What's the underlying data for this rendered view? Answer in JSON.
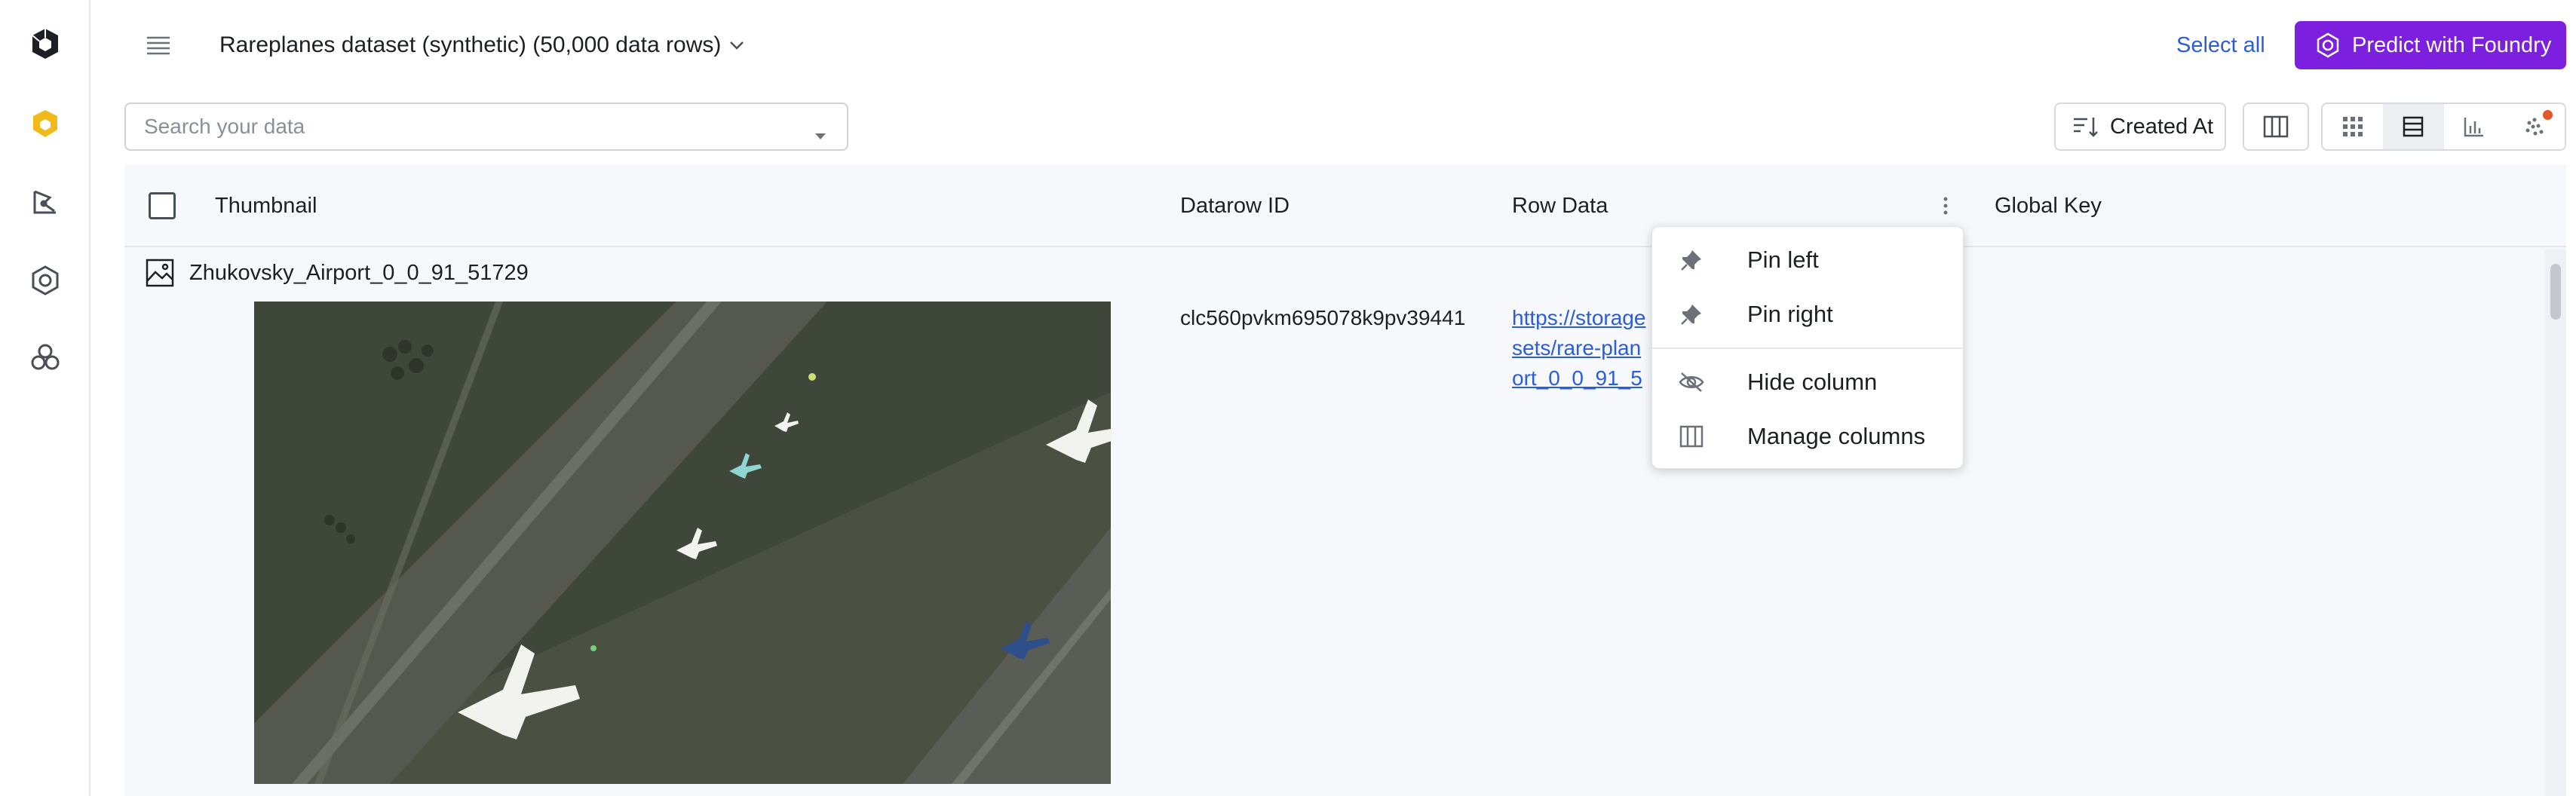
{
  "header": {
    "dataset_title": "Rareplanes dataset (synthetic) (50,000 data rows)",
    "select_all_label": "Select all",
    "predict_label": "Predict with Foundry"
  },
  "search": {
    "placeholder": "Search your data"
  },
  "toolbar": {
    "sort_label": "Created At"
  },
  "table": {
    "columns": [
      "Thumbnail",
      "Datarow ID",
      "Row Data",
      "Global Key"
    ],
    "rows": [
      {
        "name": "Zhukovsky_Airport_0_0_91_51729",
        "datarow_id": "clc560pvkm695078k9pv39441",
        "row_data_lines": [
          "https://storage",
          "sets/rare-plan",
          "ort_0_0_91_5"
        ]
      }
    ]
  },
  "context_menu": {
    "items": [
      "Pin left",
      "Pin right",
      "Hide column",
      "Manage columns"
    ]
  },
  "colors": {
    "accent": "#7c1fde",
    "link": "#2b5ddb",
    "logo_yellow": "#f2b91a",
    "notification": "#e3572b"
  },
  "icons": [
    "logo-icon",
    "catalog-icon",
    "annotate-icon",
    "model-icon",
    "foundry-icon",
    "hamburger-icon",
    "chevron-down-icon",
    "sort-icon",
    "columns-icon",
    "grid-view-icon",
    "list-view-icon",
    "chart-view-icon",
    "cluster-view-icon",
    "image-icon",
    "kebab-icon",
    "pin-icon",
    "eye-off-icon"
  ]
}
